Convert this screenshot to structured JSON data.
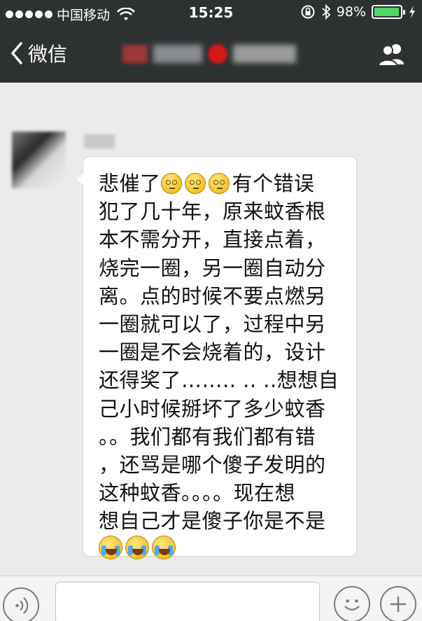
{
  "status_bar": {
    "carrier": "中国移动",
    "time": "15:25",
    "battery_percent": "98%",
    "battery_level": 0.98,
    "signal_icon": "signal-dots-icon",
    "wifi_icon": "wifi-icon",
    "lock_icon": "orientation-lock-icon",
    "bluetooth_icon": "bluetooth-icon",
    "charging_icon": "charging-bolt-icon"
  },
  "nav_bar": {
    "back_label": "微信",
    "back_icon": "chevron-left-icon",
    "group_icon": "group-people-icon"
  },
  "message": {
    "lines": [
      "悲催了",
      "犯了几十年，原来蚊香根",
      "本不需分开，直接点着，",
      "烧完一圈，另一圈自动分",
      "离。点的时候不要点燃另",
      "一圈就可以了，过程中另",
      "一圈是不会烧着的，设计",
      "还得奖了…….. .. ..想想自",
      "己小时候掰坏了多少蚊香",
      "。。我们都有我们都有错",
      "，还骂是哪个傻子发明的",
      "这种蚊香。。。。现在想",
      "想自己才是傻子你是不是"
    ],
    "line1_suffix": "有个错误",
    "emoji_dizzy": "dizzy-face-emoji-icon",
    "emoji_cry": "crying-laugh-emoji-icon"
  },
  "input_bar": {
    "text_value": "",
    "voice_icon": "voice-waves-icon",
    "emoji_icon": "smiley-face-icon",
    "plus_icon": "plus-icon"
  },
  "colors": {
    "bar_bg": "#2e3132",
    "chat_bg": "#ebebeb",
    "battery_green": "#4cd964"
  }
}
